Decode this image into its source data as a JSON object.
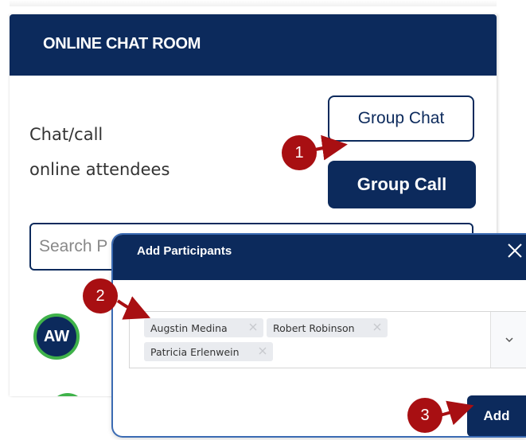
{
  "panel": {
    "title": "ONLINE CHAT ROOM",
    "description_line1": "Chat/call",
    "description_line2": "online attendees",
    "group_chat_label": "Group Chat",
    "group_call_label": "Group Call",
    "search_placeholder": "Search P",
    "attendee_initials": "AW"
  },
  "modal": {
    "title": "Add Participants",
    "participants": [
      "Augstin Medina",
      "Robert Robinson",
      "Patricia Erlenwein"
    ],
    "add_label": "Add"
  },
  "markers": [
    "1",
    "2",
    "3"
  ],
  "colors": {
    "navy": "#0c2a5c",
    "marker_red": "#a80f12",
    "online_green": "#3fb24a",
    "modal_border": "#3b6bb3"
  },
  "icons": {
    "close": "close-icon",
    "chip_remove": "remove-chip-icon",
    "dropdown": "chevron-down-icon"
  }
}
